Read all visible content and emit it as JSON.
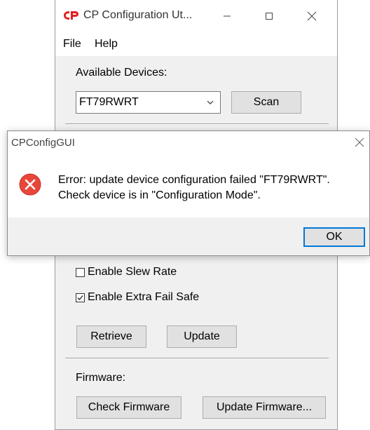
{
  "main_window": {
    "title": "CP Configuration Ut...",
    "menu": {
      "file": "File",
      "help": "Help"
    },
    "available_devices_label": "Available Devices:",
    "device_select_value": "FT79RWRT",
    "scan_button": "Scan",
    "checkboxes": [
      {
        "label": "Enable Slew Rate",
        "checked": false
      },
      {
        "label": "Enable Extra Fail Safe",
        "checked": true
      }
    ],
    "retrieve_button": "Retrieve",
    "update_button": "Update",
    "firmware_label": "Firmware:",
    "check_firmware_button": "Check Firmware",
    "update_firmware_button": "Update Firmware..."
  },
  "dialog": {
    "title": "CPConfigGUI",
    "message_line1": "Error: update device configuration failed \"FT79RWRT\".",
    "message_line2": "Check device is in \"Configuration Mode\".",
    "ok_button": "OK"
  },
  "colors": {
    "logo_red": "#e02020",
    "error_red": "#e8463a",
    "focus_blue": "#0078d7",
    "face": "#f0f0f0",
    "button": "#e1e1e1"
  },
  "icons": {
    "app_logo": "cp-logo-icon",
    "minimize": "minimize-icon",
    "maximize": "maximize-icon",
    "close": "close-icon",
    "dropdown": "chevron-down-icon",
    "error": "error-icon",
    "checkmark": "checkmark-icon"
  }
}
